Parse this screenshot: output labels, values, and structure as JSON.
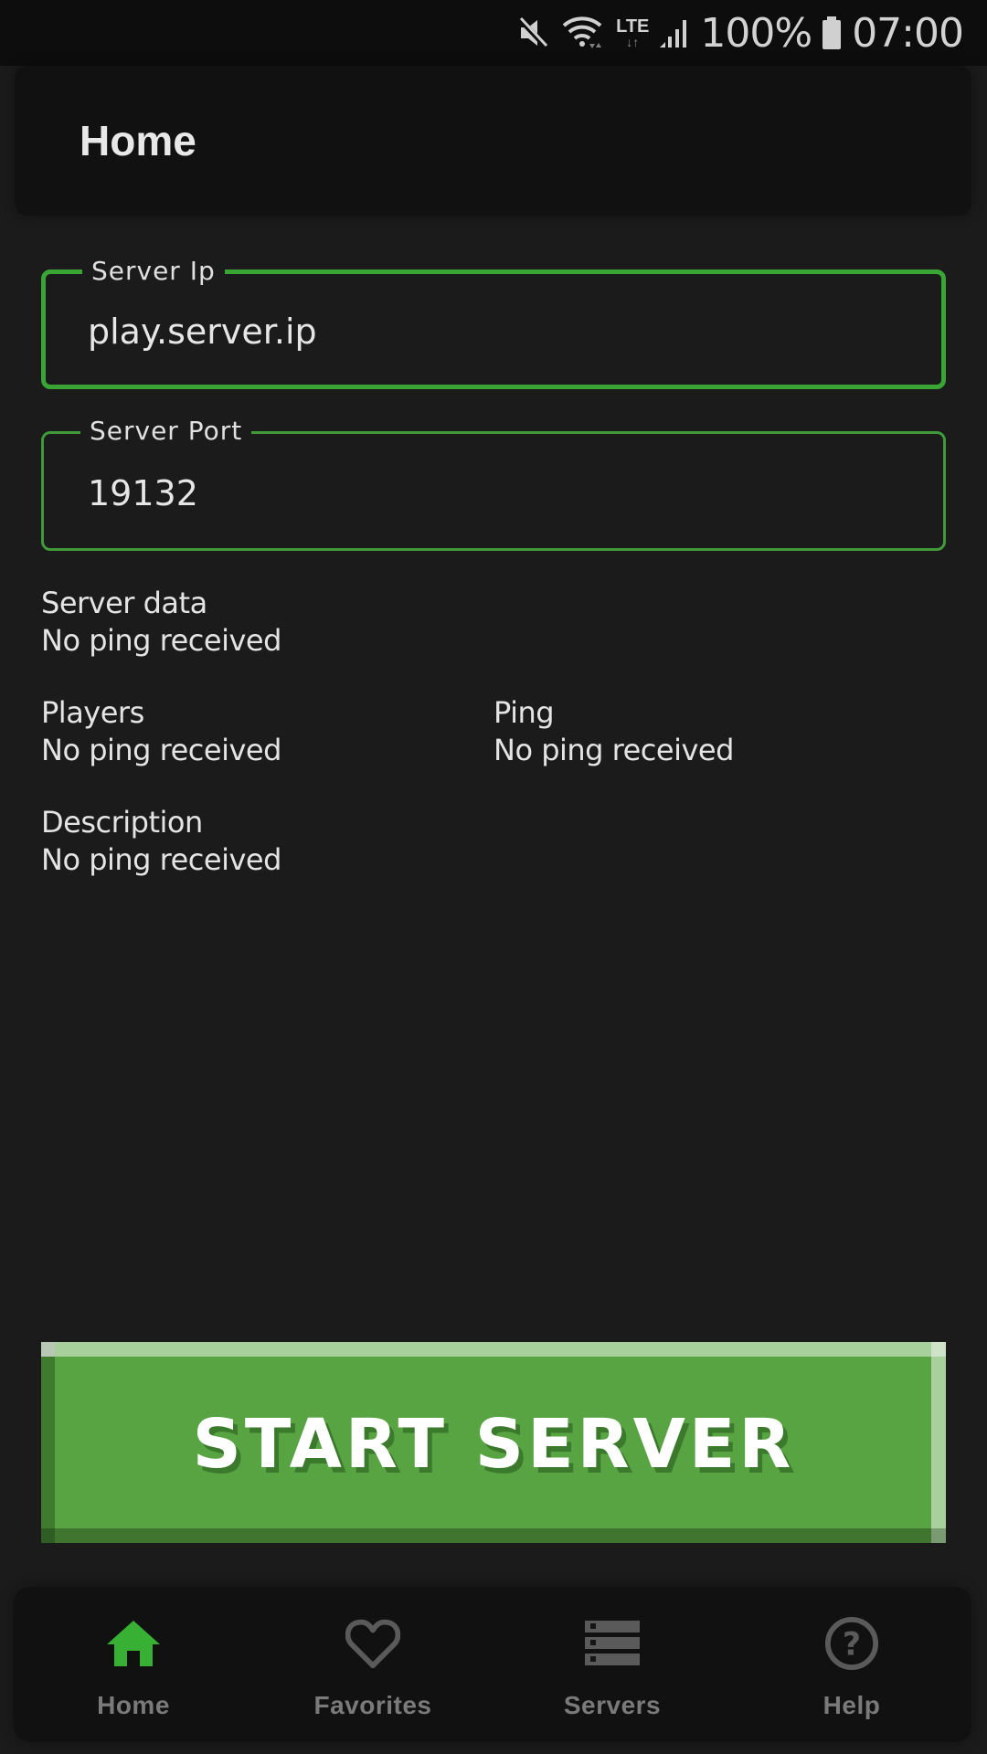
{
  "status_bar": {
    "icons": [
      "mute-icon",
      "wifi-icon",
      "lte-icon",
      "signal-icon",
      "battery-icon"
    ],
    "lte_label": "LTE",
    "battery_percent": "100%",
    "time": "07:00"
  },
  "header": {
    "title": "Home"
  },
  "form": {
    "server_ip": {
      "label": "Server Ip",
      "value": "play.server.ip",
      "focused": true
    },
    "server_port": {
      "label": "Server Port",
      "value": "19132"
    }
  },
  "server_info": {
    "server_data": {
      "label": "Server data",
      "value": "No ping received"
    },
    "players": {
      "label": "Players",
      "value": "No ping received"
    },
    "ping": {
      "label": "Ping",
      "value": "No ping received"
    },
    "description": {
      "label": "Description",
      "value": "No ping received"
    }
  },
  "start_button": {
    "label": "START SERVER"
  },
  "bottom_nav": {
    "items": [
      {
        "label": "Home",
        "icon": "home-icon",
        "active": true
      },
      {
        "label": "Favorites",
        "icon": "heart-icon",
        "active": false
      },
      {
        "label": "Servers",
        "icon": "server-stack-icon",
        "active": false
      },
      {
        "label": "Help",
        "icon": "help-circle-icon",
        "active": false
      }
    ]
  },
  "colors": {
    "accent": "#38a534",
    "button_green": "#58a443",
    "background": "#1b1b1b",
    "card": "#111111",
    "inactive_nav": "#7a7a7a"
  }
}
